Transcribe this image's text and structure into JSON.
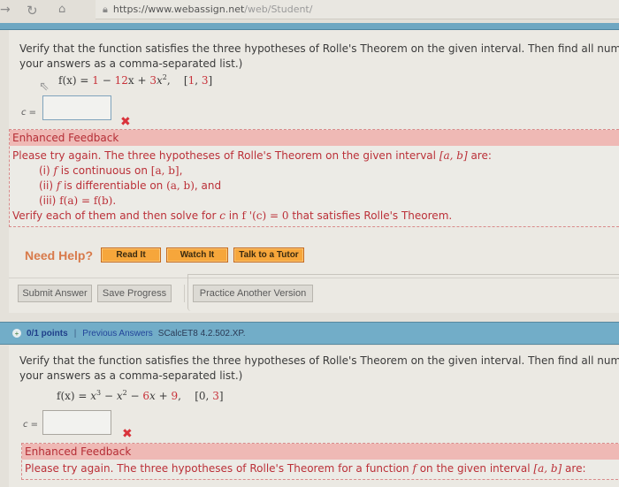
{
  "browser": {
    "url_main": "https://www.webassign.net",
    "url_rest": "/web/Student/"
  },
  "question1": {
    "prompt_line1": "Verify that the function satisfies the three hypotheses of Rolle's Theorem on the given interval. Then find all numbers",
    "prompt_line2": "your answers as a comma-separated list.)",
    "function_lhs": "f(x) = ",
    "function_terms": [
      "1",
      " − ",
      "12",
      "x + ",
      "3",
      "x",
      "2"
    ],
    "interval": [
      "1",
      "3"
    ],
    "answer_label": "c =",
    "answer_value": "",
    "status": "incorrect",
    "feedback": {
      "title": "Enhanced Feedback",
      "intro_pre": "Please try again. The three hypotheses of Rolle's Theorem on the given interval ",
      "intro_interval": "[a, b]",
      "intro_post": " are:",
      "items": [
        {
          "num": "(i)",
          "text_pre": " f",
          "text_mid": " is continuous on ",
          "math": "[a, b]",
          "text_post": ","
        },
        {
          "num": "(ii)",
          "text_pre": " f",
          "text_mid": " is differentiable on ",
          "math": "(a, b)",
          "text_post": ",  and"
        },
        {
          "num": "(iii)",
          "text_pre": " ",
          "text_mid": "",
          "math": "f(a) = f(b)",
          "text_post": "."
        }
      ],
      "closing_pre": "Verify each of them and then solve for ",
      "closing_c": "c",
      "closing_mid": " in ",
      "closing_eq": "f '(c) = 0",
      "closing_post": " that satisfies Rolle's Theorem."
    },
    "help": {
      "label": "Need Help?",
      "buttons": [
        "Read It",
        "Watch It",
        "Talk to a Tutor"
      ]
    },
    "actions": {
      "submit": "Submit Answer",
      "save": "Save Progress",
      "practice": "Practice Another Version"
    }
  },
  "question2": {
    "points": "0/1 points",
    "separator": "|",
    "previous_answers": "Previous Answers",
    "code": "SCalcET8 4.2.502.XP.",
    "prompt_line1": "Verify that the function satisfies the three hypotheses of Rolle's Theorem on the given interval. Then find all numbers",
    "prompt_line2": "your answers as a comma-separated list.)",
    "function_lhs": "f(x) = ",
    "interval": [
      "0",
      "3"
    ],
    "answer_label": "c =",
    "answer_value": "",
    "status": "incorrect",
    "feedback": {
      "title": "Enhanced Feedback",
      "intro_pre": "Please try again. The three hypotheses of Rolle's Theorem for a function ",
      "intro_f": "f",
      "intro_mid": " on the given interval ",
      "intro_interval": "[a, b]",
      "intro_post": " are:"
    }
  },
  "colors": {
    "accent_blue": "#72adc8",
    "error_red": "#c8323a",
    "feedback_bg": "#efb9b5",
    "help_orange": "#f6a63b"
  }
}
